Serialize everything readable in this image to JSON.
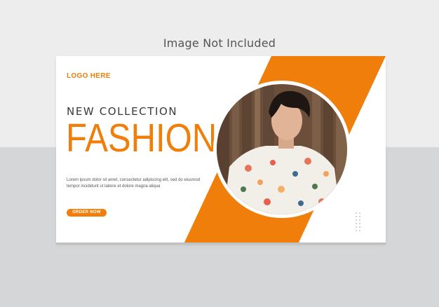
{
  "watermark_note": "Image Not Included",
  "banner": {
    "logo": "LOGO HERE",
    "subtitle": "NEW COLLECTION",
    "headline": "FASHION",
    "body_line1": "Lorem ipsum dolor sit amet, consectetur adipiscing elit, sed do eiusmod",
    "body_line2": "tempor incididunt ut labore et dolore magna aliqua",
    "cta_label": "ORDER NOW",
    "photo_icon": "person-photo-icon",
    "dots_icon": "dot-grid-icon"
  },
  "colors": {
    "accent": "#f07e0a",
    "text_dark": "#3a3a3a",
    "page_light": "#ededed",
    "page_gray": "#d5d6d8"
  }
}
